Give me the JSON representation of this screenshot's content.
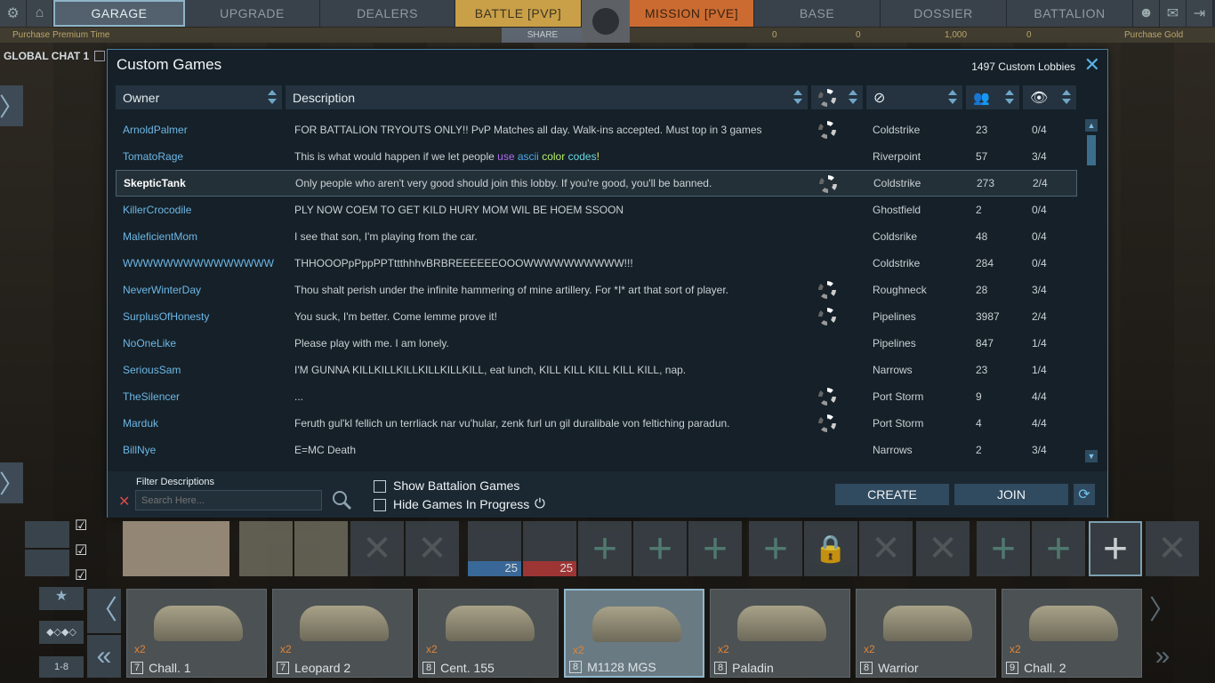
{
  "nav": {
    "tabs": [
      "GARAGE",
      "UPGRADE",
      "DEALERS",
      "BATTLE [PVP]",
      "MISSION [PVE]",
      "BASE",
      "DOSSIER",
      "BATTALION"
    ]
  },
  "subbar": {
    "premium": "Purchase Premium Time",
    "share": "SHARE",
    "cur1": "0",
    "cur2": "0",
    "cur3": "1,000",
    "cur4": "0",
    "gold": "Purchase Gold"
  },
  "chat": {
    "label": "GLOBAL CHAT 1"
  },
  "dialog": {
    "title": "Custom Games",
    "count": "1497 Custom Lobbies",
    "columns": {
      "owner": "Owner",
      "description": "Description"
    },
    "rows": [
      {
        "owner": "ArnoldPalmer",
        "desc": "FOR BATTALION TRYOUTS ONLY!! PvP Matches all day. Walk-ins accepted. Must top in 3 games",
        "spin": true,
        "map": "Coldstrike",
        "players": "23",
        "spec": "0/4"
      },
      {
        "owner": "TomatoRage",
        "desc": "This is what would happen if we let people ",
        "spin": false,
        "map": "Riverpoint",
        "players": "57",
        "spec": "3/4",
        "colored": true
      },
      {
        "owner": "SkepticTank",
        "desc": "Only people who aren't very good should join this lobby. If you're good, you'll be banned.",
        "spin": true,
        "map": "Coldstrike",
        "players": "273",
        "spec": "2/4",
        "selected": true
      },
      {
        "owner": "KillerCrocodile",
        "desc": "PLY NOW COEM TO GET KILD HURY MOM WIL BE HOEM SSOON",
        "spin": false,
        "map": "Ghostfield",
        "players": "2",
        "spec": "0/4"
      },
      {
        "owner": "MaleficientMom",
        "desc": "I see that son, I'm playing from the car.",
        "spin": false,
        "map": "Coldsrike",
        "players": "48",
        "spec": "0/4"
      },
      {
        "owner": "WWWWWWWWWWWWWWW",
        "desc": "THHOOOPpPppPPTttthhhvBRBREEEEEEOOOWWWWWWWWWW!!!",
        "spin": false,
        "map": "Coldstrike",
        "players": "284",
        "spec": "0/4"
      },
      {
        "owner": "NeverWinterDay",
        "desc": "Thou shalt perish under the infinite hammering of mine artillery. For *I* art that sort of player.",
        "spin": true,
        "map": "Roughneck",
        "players": "28",
        "spec": "3/4"
      },
      {
        "owner": "SurplusOfHonesty",
        "desc": "You suck, I'm better. Come lemme prove it!",
        "spin": true,
        "map": "Pipelines",
        "players": "3987",
        "spec": "2/4"
      },
      {
        "owner": "NoOneLike",
        "desc": "Please play with me. I am lonely.",
        "spin": false,
        "map": "Pipelines",
        "players": "847",
        "spec": "1/4"
      },
      {
        "owner": "SeriousSam",
        "desc": "I'M GUNNA KILLKILLKILLKILLKILLKILL, eat lunch, KILL KILL KILL KILL KILL, nap.",
        "spin": false,
        "map": "Narrows",
        "players": "23",
        "spec": "1/4"
      },
      {
        "owner": "TheSilencer",
        "desc": "...",
        "spin": true,
        "map": "Port Storm",
        "players": "9",
        "spec": "4/4"
      },
      {
        "owner": "Marduk",
        "desc": "Feruth gul'kl fellich un terrliack nar vu'hular, zenk furl un gil duralibale von feltiching paradun.",
        "spin": true,
        "map": "Port Storm",
        "players": "4",
        "spec": "4/4"
      },
      {
        "owner": "BillNye",
        "desc": "E=MC Death",
        "spin": false,
        "map": "Narrows",
        "players": "2",
        "spec": "3/4"
      }
    ],
    "colored_words": [
      "use",
      "ascii",
      "color",
      "codes",
      "!"
    ],
    "filter": {
      "label": "Filter Descriptions",
      "placeholder": "Search Here..."
    },
    "show_battalion": "Show Battalion Games",
    "hide_progress": "Hide Games In Progress",
    "create": "CREATE",
    "join": "JOIN"
  },
  "consumables": [
    {
      "value": "25",
      "color": "#3f77b0"
    },
    {
      "value": "25",
      "color": "#b43b3b"
    }
  ],
  "tier_range": "1-8",
  "vehicles": [
    {
      "tier": "7",
      "name": "Chall. 1",
      "count": "x2"
    },
    {
      "tier": "7",
      "name": "Leopard 2",
      "count": "x2"
    },
    {
      "tier": "8",
      "name": "Cent. 155",
      "count": "x2"
    },
    {
      "tier": "8",
      "name": "M1128 MGS",
      "count": "x2",
      "selected": true
    },
    {
      "tier": "8",
      "name": "Paladin",
      "count": "x2"
    },
    {
      "tier": "8",
      "name": "Warrior",
      "count": "x2"
    },
    {
      "tier": "9",
      "name": "Chall. 2",
      "count": "x2"
    }
  ]
}
